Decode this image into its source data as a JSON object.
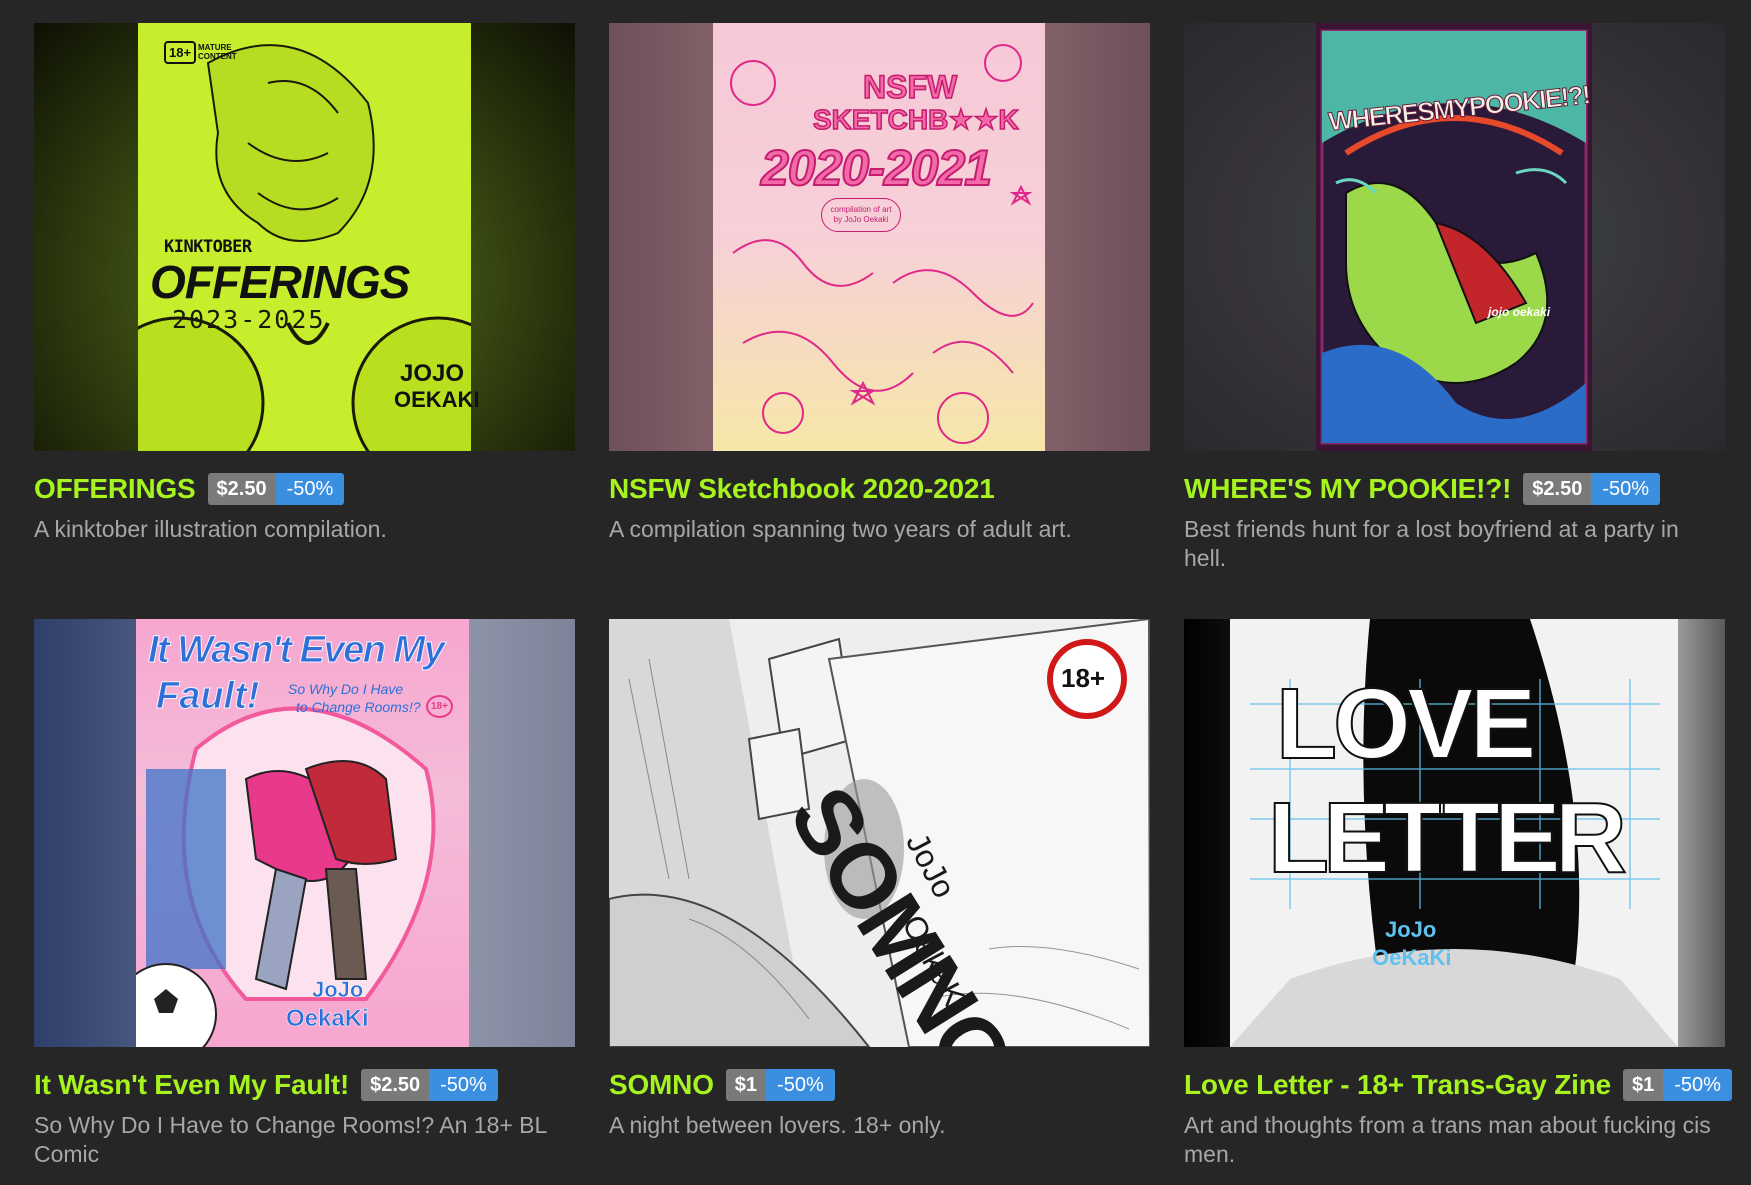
{
  "colors": {
    "background": "#262626",
    "title": "#a6f31f",
    "description": "#a7a7a7",
    "price_badge": "#7a7a7a",
    "sale_badge": "#3b8fe0"
  },
  "items": [
    {
      "title": "OFFERINGS",
      "price": "$2.50",
      "sale": "-50%",
      "description": "A kinktober illustration compilation.",
      "cover": {
        "badge": "18+",
        "badge_note": "MATURE CONTENT",
        "kicker": "KINKTOBER",
        "headline": "OFFERINGS",
        "years": "2023-2025",
        "author_line1": "JOJO",
        "author_line2": "OEKAKI",
        "accent": "#c8f02a"
      }
    },
    {
      "title": "NSFW Sketchbook 2020-2021",
      "price": "",
      "sale": "",
      "description": "A compilation spanning two years of adult art.",
      "cover": {
        "line1": "NSFW",
        "line2": "SKETCHB★★K",
        "years": "2020-2021",
        "note": "compilation of art by JoJo Oekaki",
        "accent": "#e8338c"
      }
    },
    {
      "title": "WHERE'S MY POOKIE!?!",
      "price": "$2.50",
      "sale": "-50%",
      "description": "Best friends hunt for a lost boyfriend at a party in hell.",
      "cover": {
        "headline": "WHERESMYPOOKIE!?!",
        "author": "jojo oekaki",
        "accent": "#6bd6c0"
      }
    },
    {
      "title": "It Wasn't Even My Fault!",
      "price": "$2.50",
      "sale": "-50%",
      "description": "So Why Do I Have to Change Rooms!? An 18+ BL Comic",
      "cover": {
        "headline_line1": "It Wasn't Even My",
        "headline_line2": "Fault!",
        "subtitle_line1": "So Why Do I Have",
        "subtitle_line2": "to Change Rooms!?",
        "badge": "18+",
        "author_line1": "JoJo",
        "author_line2": "OekaKi",
        "accent": "#2f6fd8"
      }
    },
    {
      "title": "SOMNO",
      "price": "$1",
      "sale": "-50%",
      "description": "A night between lovers. 18+ only.",
      "cover": {
        "headline": "SOMNO",
        "author_line1": "JoJo",
        "author_line2": "OekaKi",
        "badge": "18+"
      }
    },
    {
      "title": "Love Letter - 18+ Trans-Gay Zine",
      "price": "$1",
      "sale": "-50%",
      "description": "Art and thoughts from a trans man about fucking cis men.",
      "cover": {
        "line1": "LOVE",
        "line2": "LETTER",
        "author_line1": "JoJo",
        "author_line2": "OeKaKi",
        "accent": "#5fc1ee"
      }
    }
  ]
}
